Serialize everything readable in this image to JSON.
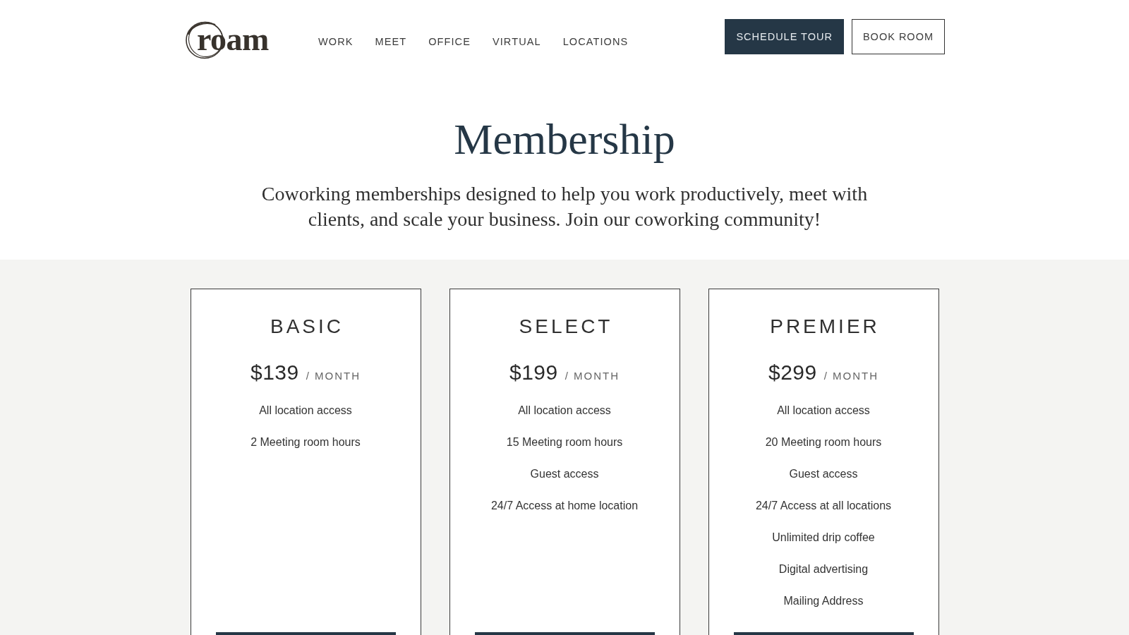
{
  "header": {
    "logo": "roam",
    "nav": [
      "WORK",
      "MEET",
      "OFFICE",
      "VIRTUAL",
      "LOCATIONS"
    ],
    "actions": [
      {
        "label": "SCHEDULE TOUR",
        "kind": "filled"
      },
      {
        "label": "BOOK ROOM",
        "kind": "outline"
      }
    ]
  },
  "hero": {
    "title": "Membership",
    "subtitle": "Coworking memberships designed to help you work productively, meet with clients, and scale your business. Join our coworking community!"
  },
  "plans": [
    {
      "name": "BASIC",
      "price": "$139",
      "period": "/ MONTH",
      "features": [
        "All location access",
        "2 Meeting room hours"
      ]
    },
    {
      "name": "SELECT",
      "price": "$199",
      "period": "/ MONTH",
      "features": [
        "All location access",
        "15 Meeting room hours",
        "Guest access",
        "24/7 Access at home location"
      ]
    },
    {
      "name": "PREMIER",
      "price": "$299",
      "period": "/ MONTH",
      "features": [
        "All location access",
        "20 Meeting room hours",
        "Guest access",
        "24/7 Access at all locations",
        "Unlimited drip coffee",
        "Digital advertising",
        "Mailing Address"
      ]
    }
  ]
}
